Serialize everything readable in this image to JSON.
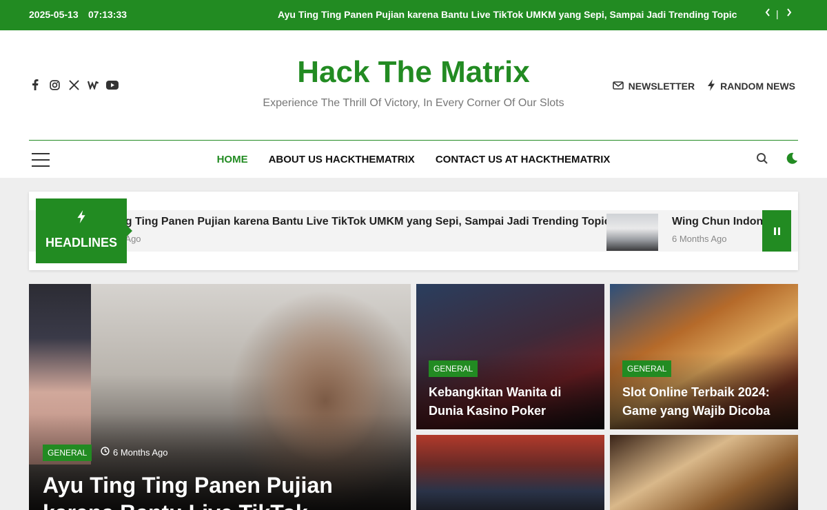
{
  "topbar": {
    "date": "2025-05-13",
    "time": "07:13:33",
    "ticker_text": "Ayu Ting Ting Panen Pujian karena Bantu Live TikTok UMKM yang Sepi, Sampai Jadi Trending Topic",
    "prev_icon": "chevron-left",
    "separator": "|",
    "next_icon": "chevron-right"
  },
  "header": {
    "site_title": "Hack The Matrix",
    "tagline": "Experience The Thrill Of Victory, In Every Corner Of Our Slots",
    "social_icons": [
      "facebook-icon",
      "instagram-icon",
      "x-twitter-icon",
      "wordpress-icon",
      "youtube-icon"
    ],
    "newsletter_label": "NEWSLETTER",
    "random_news_label": "RANDOM NEWS"
  },
  "nav": {
    "items": [
      {
        "label": "HOME",
        "active": true
      },
      {
        "label": "ABOUT US HACKTHEMATRIX",
        "active": false
      },
      {
        "label": "CONTACT US AT HACKTHEMATRIX",
        "active": false
      }
    ]
  },
  "headlines": {
    "label": "HEADLINES",
    "items": [
      {
        "title": "ng Ting Panen Pujian karena Bantu Live TikTok UMKM yang Sepi, Sampai Jadi Trending Topic",
        "ago": "s Ago"
      },
      {
        "title": "Wing Chun Indone",
        "ago": "6 Months Ago"
      }
    ]
  },
  "featured": {
    "category": "GENERAL",
    "ago": "6 Months Ago",
    "title": "Ayu Ting Ting Panen Pujian karena Bantu Live TikTok"
  },
  "cards": [
    {
      "category": "GENERAL",
      "title": "Kebangkitan Wanita di Dunia Kasino Poker"
    },
    {
      "category": "GENERAL",
      "title": "Slot Online Terbaik 2024: Game yang Wajib Dicoba"
    },
    {
      "category": "",
      "title": ""
    },
    {
      "category": "",
      "title": ""
    }
  ],
  "colors": {
    "brand_green": "#228b22",
    "topbar_bg": "#228b22",
    "page_bg": "#eeeeee"
  }
}
